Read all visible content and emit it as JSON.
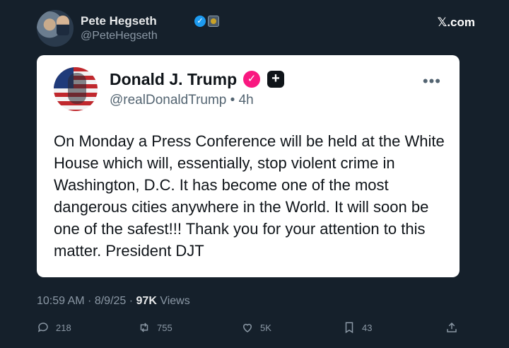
{
  "header": {
    "name": "Pete Hegseth",
    "handle": "@PeteHegseth",
    "site": "𝕏.com"
  },
  "quoted": {
    "name": "Donald J. Trump",
    "handle_time": "@realDonaldTrump • 4h",
    "more": "•••",
    "body": "On Monday a Press Conference will be held at the White House which will, essentially, stop violent crime in Washington, D.C. It has become one of the most dangerous cities anywhere in the World. It will soon be one of the safest!!! Thank you for your attention to this matter. President DJT"
  },
  "meta": {
    "time_date": "10:59 AM · 8/9/25 · ",
    "views_count": "97K",
    "views_label": " Views"
  },
  "actions": {
    "replies": "218",
    "reposts": "755",
    "likes": "5K",
    "bookmarks": "43"
  },
  "colors": {
    "background": "#15202b",
    "card": "#ffffff",
    "verified_blue": "#1d9bf0",
    "verified_pink": "#f91880",
    "muted": "#8b98a5"
  }
}
